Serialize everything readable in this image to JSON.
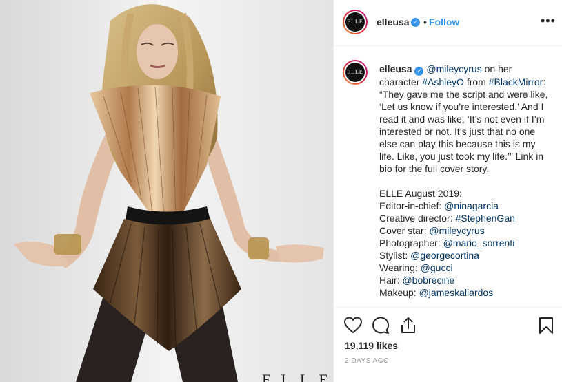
{
  "photo": {
    "watermark_text": "ELLE"
  },
  "header": {
    "avatar_text": "ELLE",
    "username": "elleusa",
    "verified_icon": "verified-badge-icon",
    "separator": "•",
    "follow_label": "Follow",
    "more_label": "•••"
  },
  "caption": {
    "avatar_text": "ELLE",
    "username": "elleusa",
    "verified_icon": "verified-badge-icon",
    "mention_1": "@mileycyrus",
    "text_1": " on her character ",
    "hashtag_1": "#AshleyO",
    "text_2": " from ",
    "hashtag_2": "#BlackMirror",
    "quote": ": “They gave me the script and were like, ‘Let us know if you’re interested.’ And I read it and was like, ‘It’s not even if I’m interested or not. It’s just that no one else can play this because this is my life. Like, you just took my life.’” Link in bio for the full cover story.",
    "credits_title": "ELLE August 2019:",
    "credits": [
      {
        "label": "Editor-in-chief: ",
        "handle": "@ninagarcia"
      },
      {
        "label": "Creative director: ",
        "handle": "#StephenGan"
      },
      {
        "label": "Cover star: ",
        "handle": "@mileycyrus"
      },
      {
        "label": "Photographer: ",
        "handle": "@mario_sorrenti"
      },
      {
        "label": "Stylist: ",
        "handle": "@georgecortina"
      },
      {
        "label": "Wearing: ",
        "handle": "@gucci"
      },
      {
        "label": "Hair: ",
        "handle": "@bobrecine"
      },
      {
        "label": "Makeup: ",
        "handle": "@jameskaliardos"
      }
    ]
  },
  "actions": {
    "icons": [
      "heart-icon",
      "comment-icon",
      "share-icon",
      "bookmark-icon"
    ],
    "likes": "19,119 likes",
    "timestamp": "2 DAYS AGO"
  },
  "colors": {
    "link": "#003569",
    "follow": "#3897f0",
    "verified": "#3897f0",
    "text": "#262626",
    "muted": "#999999",
    "border": "#efefef"
  }
}
